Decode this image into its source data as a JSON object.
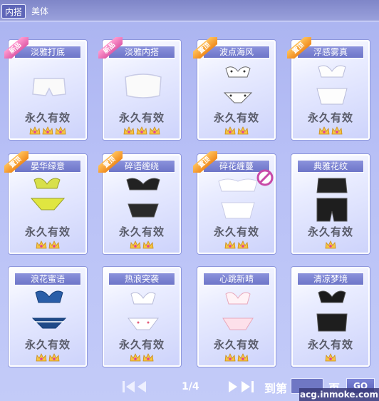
{
  "tabs": [
    {
      "label": "内搭",
      "active": true
    },
    {
      "label": "美体",
      "active": false
    }
  ],
  "valid_text": "永久有效",
  "items": [
    {
      "name": "淡雅打底",
      "ribbon": "新品",
      "ribbon_color": "pink",
      "crowns": 3,
      "item": "shorts-white"
    },
    {
      "name": "淡雅内搭",
      "ribbon": "新品",
      "ribbon_color": "pink",
      "crowns": 3,
      "item": "tube-top-white"
    },
    {
      "name": "波点海风",
      "ribbon": "置顶",
      "ribbon_color": "orange",
      "crowns": 2,
      "item": "bikini-polka"
    },
    {
      "name": "浮感雾真",
      "ribbon": "置顶",
      "ribbon_color": "orange",
      "crowns": 2,
      "item": "lingerie-white"
    },
    {
      "name": "晏华绿意",
      "ribbon": "置顶",
      "ribbon_color": "orange",
      "crowns": 2,
      "item": "bikini-green"
    },
    {
      "name": "碎语缠绕",
      "ribbon": "置顶",
      "ribbon_color": "orange",
      "crowns": 2,
      "item": "lace-black"
    },
    {
      "name": "碎花缠蔓",
      "ribbon": "置顶",
      "ribbon_color": "orange",
      "crowns": 2,
      "item": "ruffle-white",
      "forbidden": true
    },
    {
      "name": "典雅花纹",
      "ribbon": "",
      "ribbon_color": "",
      "crowns": 1,
      "item": "lace-set-black"
    },
    {
      "name": "浪花蜜语",
      "ribbon": "",
      "ribbon_color": "",
      "crowns": 2,
      "item": "bikini-blue"
    },
    {
      "name": "热浪突袭",
      "ribbon": "",
      "ribbon_color": "",
      "crowns": 2,
      "item": "bikini-white-dots"
    },
    {
      "name": "心跳新晴",
      "ribbon": "",
      "ribbon_color": "",
      "crowns": 2,
      "item": "lingerie-pink"
    },
    {
      "name": "清凉梦境",
      "ribbon": "",
      "ribbon_color": "",
      "crowns": 1,
      "item": "bikini-black"
    }
  ],
  "pager": {
    "first_icon": "first-page-icon",
    "prev_icon": "prev-page-icon",
    "next_icon": "next-page-icon",
    "last_icon": "last-page-icon",
    "page": "1/4",
    "goto_label": "到第",
    "page_suffix": "页",
    "go_label": "GO"
  },
  "watermark": "acg.inmoke.com",
  "colors": {
    "crown_gold": "#f5c544",
    "crown_gem": "#e0409a",
    "ribbon_pink": "#e05ca8",
    "ribbon_orange": "#f08a1c"
  }
}
